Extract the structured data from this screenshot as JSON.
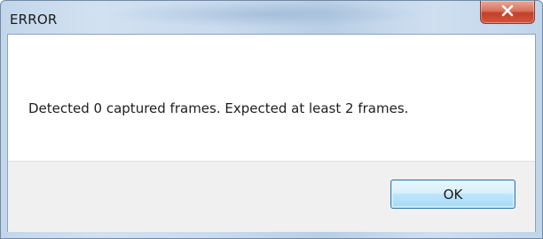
{
  "window": {
    "title": "ERROR"
  },
  "dialog": {
    "message": "Detected 0 captured frames. Expected at least 2 frames.",
    "ok_label": "OK"
  },
  "icons": {
    "close": "close-icon"
  },
  "colors": {
    "close_button": "#c7432c",
    "ok_button_border": "#3c7fb1",
    "button_area": "#f0f0f0"
  }
}
